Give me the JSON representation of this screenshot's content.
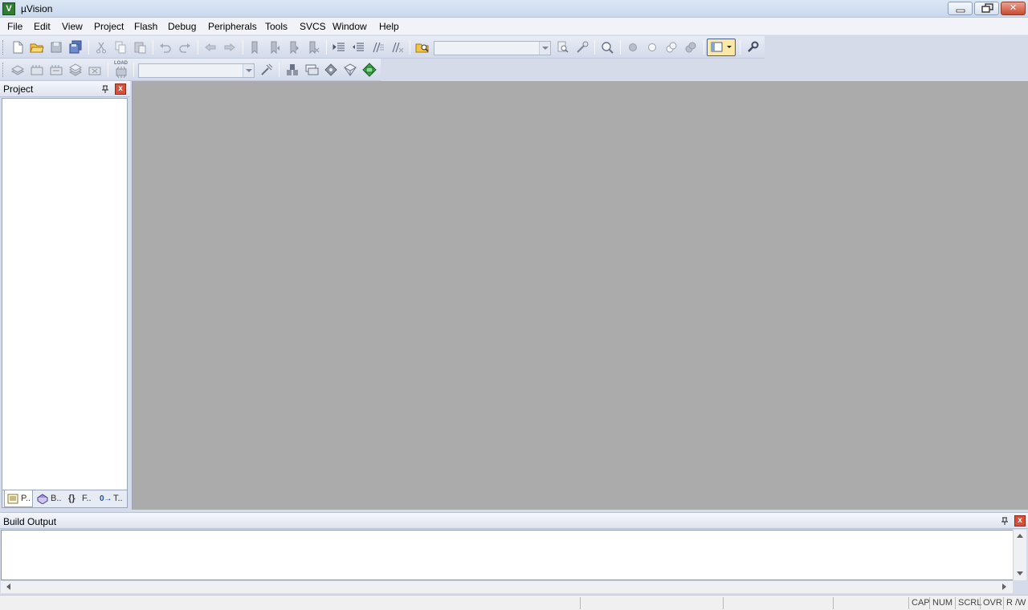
{
  "window": {
    "title": "µVision",
    "app_icon": "V",
    "controls": {
      "minimize_icon": "minimize-icon",
      "restore_icon": "restore-icon",
      "close_icon": "close-icon",
      "close_glyph": "✕"
    }
  },
  "menu": [
    "File",
    "Edit",
    "View",
    "Project",
    "Flash",
    "Debug",
    "Peripherals",
    "Tools",
    "SVCS",
    "Window",
    "Help"
  ],
  "toolbar1": {
    "combo_value": "",
    "icons": [
      "new-file-icon",
      "open-folder-icon",
      "save-icon",
      "save-all-icon",
      "cut-icon",
      "copy-icon",
      "paste-icon",
      "undo-icon",
      "redo-icon",
      "nav-back-icon",
      "nav-forward-icon",
      "bookmark-toggle-icon",
      "bookmark-prev-icon",
      "bookmark-next-icon",
      "bookmark-clear-icon",
      "indent-icon",
      "unindent-icon",
      "comment-icon",
      "uncomment-icon",
      "find-in-files-icon",
      "find-icon",
      "incremental-find-icon",
      "zoom-search-icon",
      "breakpoint-insert-icon",
      "breakpoint-enable-icon",
      "breakpoint-disable-all-icon",
      "breakpoint-kill-all-icon",
      "window-layout-icon",
      "configure-icon"
    ]
  },
  "toolbar2": {
    "combo_value": "",
    "load_label": "LOAD",
    "icons": [
      "translate-icon",
      "build-icon",
      "rebuild-icon",
      "batch-build-icon",
      "stop-build-icon",
      "download-icon",
      "target-options-icon",
      "file-extensions-icon",
      "manage-components-icon",
      "select-packs-icon",
      "pack-installer-icon",
      "run-time-env-icon"
    ]
  },
  "project_panel": {
    "title": "Project",
    "pin_icon": "pin-icon",
    "close_glyph": "x",
    "tabs": [
      {
        "label": "P..",
        "icon": "project-tab-icon",
        "active": true
      },
      {
        "label": "B..",
        "icon": "books-tab-icon",
        "active": false
      },
      {
        "label": "F..",
        "icon": "functions-tab-icon",
        "glyph": "{}",
        "active": false
      },
      {
        "label": "T..",
        "icon": "templates-tab-icon",
        "glyph": "0→",
        "active": false
      }
    ]
  },
  "build_output": {
    "title": "Build Output",
    "content": ""
  },
  "status_bar": {
    "indicators": [
      "CAP",
      "NUM",
      "SCRL",
      "OVR",
      "R /W"
    ]
  },
  "colors": {
    "editor_bg": "#ababab",
    "toolbar_bg": "#d3daea",
    "close_red": "#d8503a"
  }
}
